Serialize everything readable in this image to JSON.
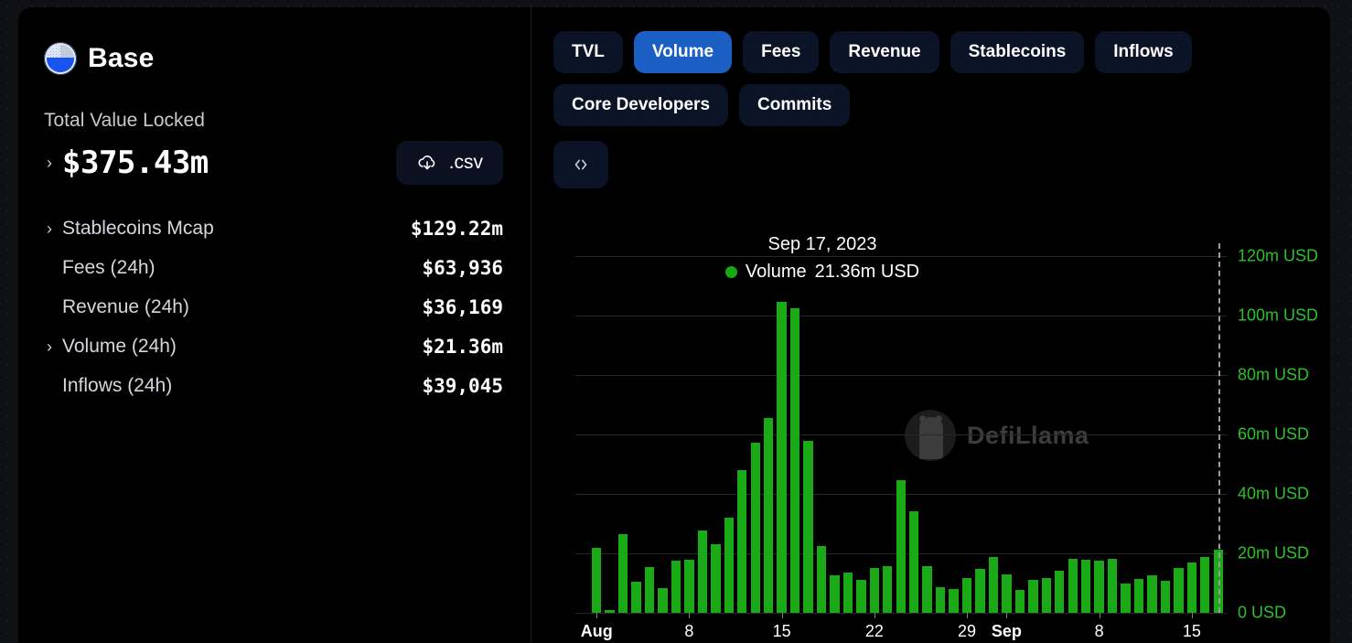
{
  "brand": {
    "name": "Base",
    "logo_icon": "base-logo-icon"
  },
  "sidebar": {
    "tvl_label": "Total Value Locked",
    "tvl_value": "$375.43m",
    "tvl_chevron": "›",
    "csv_button": {
      "label": ".csv",
      "icon": "cloud-download-icon"
    },
    "stats": [
      {
        "name": "Stablecoins Mcap",
        "value": "$129.22m",
        "expandable": true
      },
      {
        "name": "Fees (24h)",
        "value": "$63,936",
        "expandable": false
      },
      {
        "name": "Revenue (24h)",
        "value": "$36,169",
        "expandable": false
      },
      {
        "name": "Volume (24h)",
        "value": "$21.36m",
        "expandable": true
      },
      {
        "name": "Inflows (24h)",
        "value": "$39,045",
        "expandable": false
      }
    ]
  },
  "tabs": [
    {
      "label": "TVL",
      "active": false
    },
    {
      "label": "Volume",
      "active": true
    },
    {
      "label": "Fees",
      "active": false
    },
    {
      "label": "Revenue",
      "active": false
    },
    {
      "label": "Stablecoins",
      "active": false
    },
    {
      "label": "Inflows",
      "active": false
    },
    {
      "label": "Core Developers",
      "active": false
    },
    {
      "label": "Commits",
      "active": false
    }
  ],
  "code_button": {
    "label": "‹›",
    "icon": "embed-code-icon"
  },
  "tooltip": {
    "date": "Sep 17, 2023",
    "series_label": "Volume",
    "series_value": "21.36m USD",
    "dot_color": "#17a814"
  },
  "watermark": {
    "text": "DefiLlama",
    "icon": "defillama-logo-icon"
  },
  "chart_data": {
    "type": "bar",
    "title": "",
    "xlabel": "",
    "ylabel": "USD",
    "ylim": [
      0,
      120
    ],
    "yunit": "m USD",
    "grid": true,
    "legend": [
      "Volume"
    ],
    "legend_position": "tooltip",
    "bar_color": "#1aaa18",
    "ytick_labels": [
      "120m USD",
      "100m USD",
      "80m USD",
      "60m USD",
      "40m USD",
      "20m USD",
      "0 USD"
    ],
    "ytick_values": [
      120,
      100,
      80,
      60,
      40,
      20,
      0
    ],
    "xtick_labels": [
      "Aug",
      "8",
      "15",
      "22",
      "29",
      "Sep",
      "8",
      "15"
    ],
    "xtick_indices": [
      0,
      7,
      14,
      21,
      28,
      31,
      38,
      45
    ],
    "x": [
      "Aug 1",
      "Aug 2",
      "Aug 3",
      "Aug 4",
      "Aug 5",
      "Aug 6",
      "Aug 7",
      "Aug 8",
      "Aug 9",
      "Aug 10",
      "Aug 11",
      "Aug 12",
      "Aug 13",
      "Aug 14",
      "Aug 15",
      "Aug 16",
      "Aug 17",
      "Aug 18",
      "Aug 19",
      "Aug 20",
      "Aug 21",
      "Aug 22",
      "Aug 23",
      "Aug 24",
      "Aug 25",
      "Aug 26",
      "Aug 27",
      "Aug 28",
      "Aug 29",
      "Aug 30",
      "Aug 31",
      "Sep 1",
      "Sep 2",
      "Sep 3",
      "Sep 4",
      "Sep 5",
      "Sep 6",
      "Sep 7",
      "Sep 8",
      "Sep 9",
      "Sep 10",
      "Sep 11",
      "Sep 12",
      "Sep 13",
      "Sep 14",
      "Sep 15",
      "Sep 16",
      "Sep 17"
    ],
    "series": [
      {
        "name": "Volume",
        "unit": "m USD",
        "values": [
          21.8,
          0.9,
          26.6,
          10.5,
          15.4,
          8.3,
          17.4,
          17.9,
          27.7,
          23.1,
          31.9,
          48.0,
          57.2,
          65.5,
          104.5,
          102.5,
          57.8,
          22.4,
          12.6,
          13.5,
          11.2,
          15.2,
          15.8,
          44.5,
          34.2,
          15.6,
          8.6,
          8.0,
          11.7,
          14.9,
          18.9,
          12.8,
          7.6,
          11.0,
          11.8,
          14.3,
          18.1,
          17.8,
          17.5,
          18.2,
          10.0,
          11.4,
          12.7,
          10.8,
          15.0,
          17.0,
          18.9,
          21.36
        ]
      }
    ]
  }
}
